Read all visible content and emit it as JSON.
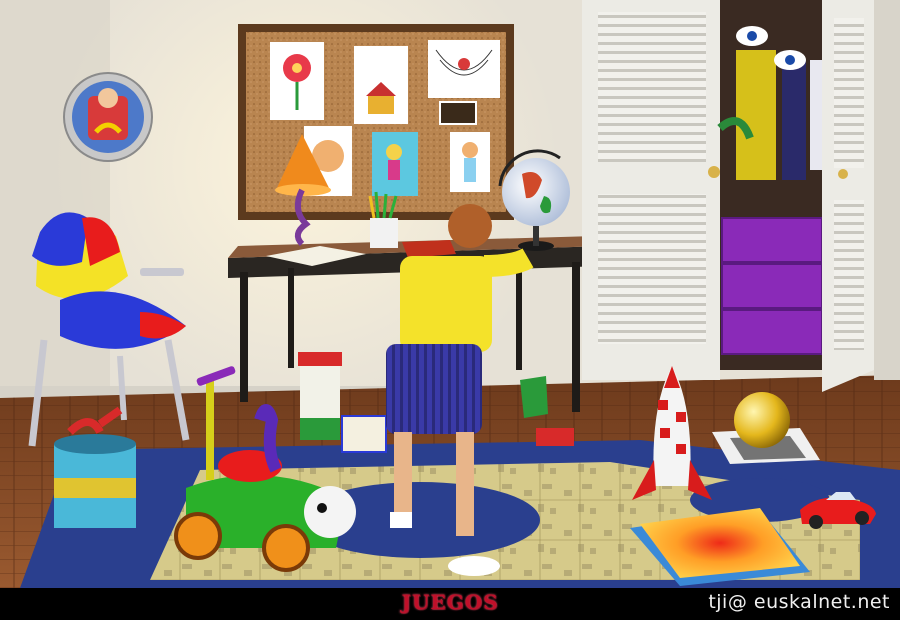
{
  "caption": {
    "title": "JUEGOS",
    "credit": "tji@ euskalnet.net"
  },
  "colors": {
    "wall": "#e6e1d6",
    "floor": "#8a4a24",
    "rug": "#2a3f8e",
    "closet_door": "#ecebe5",
    "title_red": "#c0102a"
  }
}
